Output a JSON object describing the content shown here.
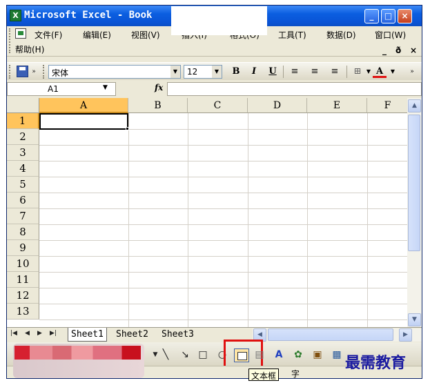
{
  "window": {
    "title": "Microsoft Excel - Book"
  },
  "menu": {
    "items": [
      "文件(F)",
      "编辑(E)",
      "视图(V)",
      "插入(I)",
      "格式(O)",
      "工具(T)",
      "数据(D)",
      "窗口(W)"
    ],
    "help": "帮助(H)",
    "mdi_min": "_",
    "mdi_restore": "ð",
    "mdi_close": "×"
  },
  "toolbar": {
    "font_name": "宋体",
    "font_size": "12",
    "bold": "B",
    "italic": "I",
    "underline": "U",
    "font_color_label": "A"
  },
  "formula_bar": {
    "name_box": "A1",
    "fx": "fx",
    "formula": ""
  },
  "grid": {
    "columns": [
      "A",
      "B",
      "C",
      "D",
      "E",
      "F"
    ],
    "rows": [
      "1",
      "2",
      "3",
      "4",
      "5",
      "6",
      "7",
      "8",
      "9",
      "10",
      "11",
      "12",
      "13"
    ],
    "selected_column": "A",
    "selected_row": "1"
  },
  "sheets": {
    "tabs": [
      "Sheet1",
      "Sheet2",
      "Sheet3"
    ],
    "active": "Sheet1"
  },
  "drawing_toolbar": {
    "tooltip": "文本框",
    "highlight_color": "#e01010"
  },
  "status": {
    "text": "字"
  },
  "watermark": {
    "text": "最需教育"
  },
  "colors": {
    "title_bar": "#0a54d6",
    "selection_header": "#ffc45c",
    "window_bg": "#ece9d8"
  }
}
